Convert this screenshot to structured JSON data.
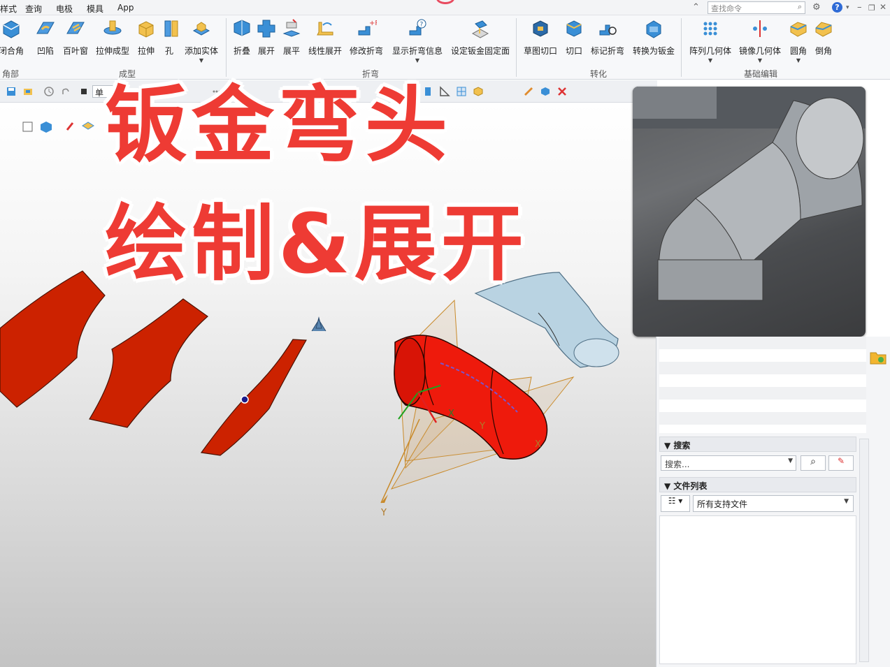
{
  "menu": {
    "items": [
      "样式",
      "查询",
      "电极",
      "模具",
      "App"
    ]
  },
  "command_search": {
    "placeholder": "查找命令"
  },
  "ribbon": {
    "buttons": [
      {
        "label": "闭合角",
        "caret": false
      },
      {
        "label": "凹陷",
        "caret": false
      },
      {
        "label": "百叶窗",
        "caret": false
      },
      {
        "label": "拉伸成型",
        "caret": false
      },
      {
        "label": "拉伸",
        "caret": false
      },
      {
        "label": "孔",
        "caret": false
      },
      {
        "label": "添加实体",
        "caret": true
      },
      {
        "label": "折叠",
        "caret": false
      },
      {
        "label": "展开",
        "caret": false
      },
      {
        "label": "展平",
        "caret": false
      },
      {
        "label": "线性展开",
        "caret": false
      },
      {
        "label": "修改折弯",
        "caret": false
      },
      {
        "label": "显示折弯信息",
        "caret": true
      },
      {
        "label": "设定钣金固定面",
        "caret": false
      },
      {
        "label": "草图切口",
        "caret": false
      },
      {
        "label": "切口",
        "caret": false
      },
      {
        "label": "标记折弯",
        "caret": false
      },
      {
        "label": "转换为钣金",
        "caret": false
      },
      {
        "label": "阵列几何体",
        "caret": true
      },
      {
        "label": "镜像几何体",
        "caret": true
      },
      {
        "label": "圆角",
        "caret": true
      },
      {
        "label": "倒角",
        "caret": false
      }
    ],
    "groups": [
      "角部",
      "成型",
      "折弯",
      "转化",
      "基础编辑"
    ]
  },
  "toolbar": {
    "filter_value": "单一"
  },
  "viewport": {
    "headline_line1": "钣金弯头",
    "headline_line2": "绘制&展开",
    "axis_labels": {
      "x": "X",
      "y": "Y",
      "y2": "Y",
      "x2": "X"
    }
  },
  "panel": {
    "search_title": "搜索",
    "search_placeholder": "搜索...",
    "filelist_title": "文件列表",
    "filter_value": "所有支持文件"
  }
}
